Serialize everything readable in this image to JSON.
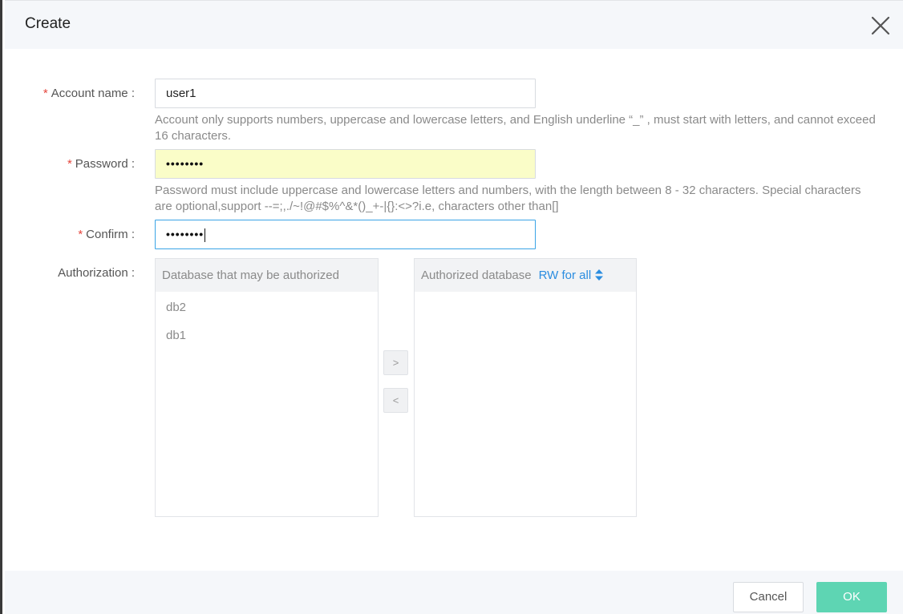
{
  "dialog": {
    "title": "Create",
    "close_icon": "close-icon"
  },
  "form": {
    "account_name": {
      "required_mark": "*",
      "label": "Account name :",
      "value": "user1",
      "hint": "Account only supports numbers, uppercase and lowercase letters, and English underline  “_” , must start with letters, and cannot exceed 16 characters."
    },
    "password": {
      "required_mark": "*",
      "label": "Password :",
      "masked_value": "••••••••",
      "hint": "Password must include uppercase and lowercase letters and numbers, with the length between 8 - 32 characters. Special characters are optional,support --=;,./~!@#$%^&*()_+-|{}:<>?i.e, characters other than[]"
    },
    "confirm": {
      "required_mark": "*",
      "label": "Confirm :",
      "masked_value": "••••••••"
    },
    "authorization": {
      "label": "Authorization :",
      "available_panel": {
        "header": "Database that may be authorized",
        "items": [
          "db2",
          "db1"
        ]
      },
      "authorized_panel": {
        "header": "Authorized database",
        "rw_link": "RW for all",
        "items": []
      },
      "move_right_label": ">",
      "move_left_label": "<"
    }
  },
  "footer": {
    "cancel_label": "Cancel",
    "ok_label": "OK"
  },
  "colors": {
    "required": "#e5463d",
    "link": "#2b8de0",
    "ok_button": "#5ed5b3",
    "autofill_bg": "#fafdc8",
    "focus_border": "#3aa4e6"
  }
}
